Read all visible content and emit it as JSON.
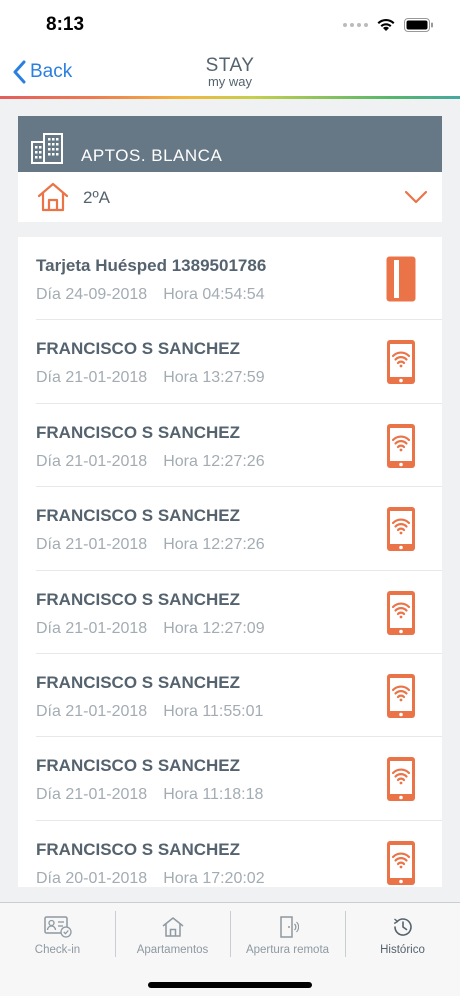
{
  "status": {
    "time": "8:13"
  },
  "nav": {
    "back_label": "Back",
    "logo_top": "STAY",
    "logo_bottom": "my way"
  },
  "building": {
    "name": "APTOS. BLANCA"
  },
  "apartment": {
    "selected": "2ºA"
  },
  "history": [
    {
      "title": "Tarjeta Huésped 1389501786",
      "day": "Día 24-09-2018",
      "time": "Hora 04:54:54",
      "icon": "card-icon"
    },
    {
      "title": "FRANCISCO S SANCHEZ",
      "day": "Día 21-01-2018",
      "time": "Hora 13:27:59",
      "icon": "phone-wifi-icon"
    },
    {
      "title": "FRANCISCO S SANCHEZ",
      "day": "Día 21-01-2018",
      "time": "Hora 12:27:26",
      "icon": "phone-wifi-icon"
    },
    {
      "title": "FRANCISCO S SANCHEZ",
      "day": "Día 21-01-2018",
      "time": "Hora 12:27:26",
      "icon": "phone-wifi-icon"
    },
    {
      "title": "FRANCISCO S SANCHEZ",
      "day": "Día 21-01-2018",
      "time": "Hora 12:27:09",
      "icon": "phone-wifi-icon"
    },
    {
      "title": "FRANCISCO S SANCHEZ",
      "day": "Día 21-01-2018",
      "time": "Hora 11:55:01",
      "icon": "phone-wifi-icon"
    },
    {
      "title": "FRANCISCO S SANCHEZ",
      "day": "Día 21-01-2018",
      "time": "Hora 11:18:18",
      "icon": "phone-wifi-icon"
    },
    {
      "title": "FRANCISCO S SANCHEZ",
      "day": "Día 20-01-2018",
      "time": "Hora 17:20:02",
      "icon": "phone-wifi-icon"
    }
  ],
  "tabs": [
    {
      "label": "Check-in",
      "icon": "id-card-icon"
    },
    {
      "label": "Apartamentos",
      "icon": "house-icon"
    },
    {
      "label": "Apertura remota",
      "icon": "door-icon"
    },
    {
      "label": "Histórico",
      "icon": "clock-icon",
      "active": true
    }
  ],
  "colors": {
    "accent": "#ea7448",
    "header": "#667886",
    "link": "#2a7fe0",
    "text": "#55636f",
    "muted": "#a3acb3"
  }
}
